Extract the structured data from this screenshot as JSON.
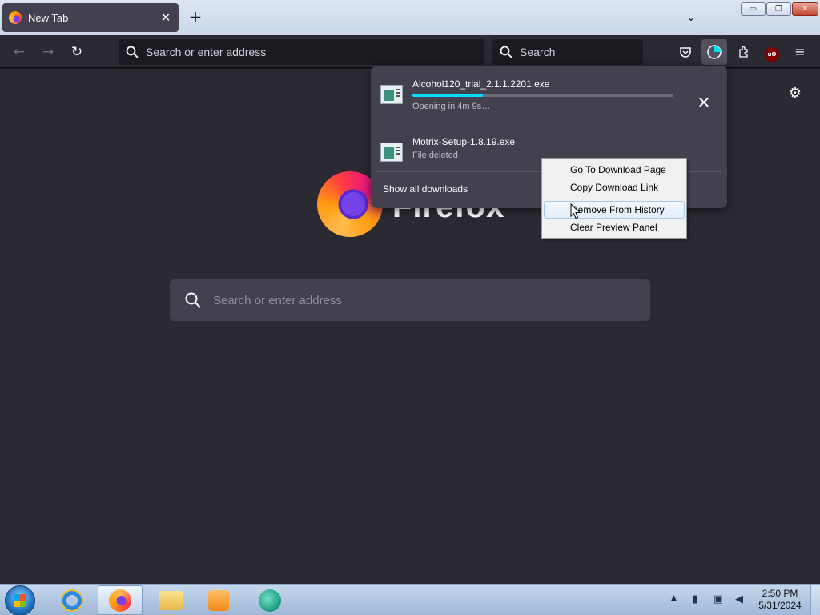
{
  "browser": {
    "tab": {
      "title": "New Tab",
      "close_glyph": "✕"
    },
    "new_tab_glyph": "+",
    "tab_list_glyph": "⌄",
    "window_controls": {
      "minimize": "▭",
      "maximize": "❐",
      "close": "✕"
    }
  },
  "toolbar": {
    "back_glyph": "←",
    "forward_glyph": "→",
    "reload_glyph": "↻",
    "url_placeholder": "Search or enter address",
    "search_placeholder": "Search",
    "menu_glyph": "≡",
    "ublock_label": "uO"
  },
  "new_tab_page": {
    "wordmark": "Firefox",
    "search_placeholder": "Search or enter address",
    "settings_glyph": "⚙"
  },
  "downloads_panel": {
    "items": [
      {
        "filename": "Alcohol120_trial_2.1.1.2201.exe",
        "status": "Opening in 4m 9s…",
        "progress": 0.27,
        "icon": "exe-file-icon"
      },
      {
        "filename": "Motrix-Setup-1.8.19.exe",
        "status": "File deleted",
        "icon": "exe-file-icon"
      }
    ],
    "cancel_glyph": "✕",
    "show_all": "Show all downloads"
  },
  "context_menu": {
    "items": [
      {
        "label": "Go To Download Page"
      },
      {
        "label": "Copy Download Link"
      },
      {
        "label": "Remove From History",
        "highlighted": true
      },
      {
        "label": "Clear Preview Panel"
      }
    ]
  },
  "taskbar": {
    "clock": {
      "time": "2:50 PM",
      "date": "5/31/2024"
    },
    "tray_up_glyph": "▲"
  },
  "colors": {
    "accent_progress": "#00ddff",
    "toolbar_bg": "#2b2a33",
    "panel_bg": "#42414d"
  }
}
